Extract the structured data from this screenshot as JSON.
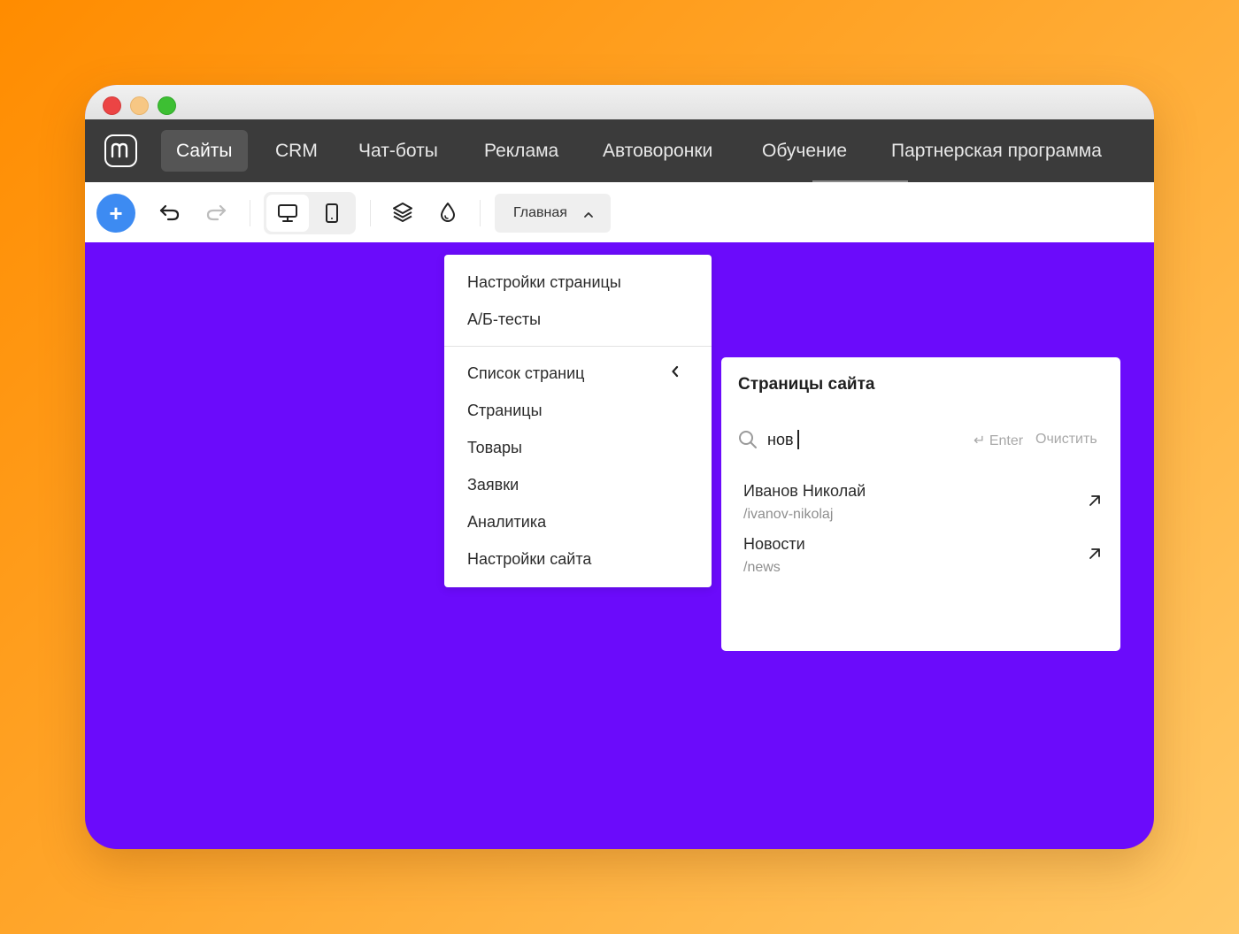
{
  "nav": {
    "items": [
      {
        "label": "Сайты",
        "active": true
      },
      {
        "label": "CRM"
      },
      {
        "label": "Чат-боты"
      },
      {
        "label": "Реклама"
      },
      {
        "label": "Автоворонки"
      },
      {
        "label": "Обучение"
      },
      {
        "label": "Партнерская программа"
      }
    ]
  },
  "toolbar": {
    "add_label": "+",
    "page_select_label": "Главная",
    "icons": [
      "undo-icon",
      "redo-icon",
      "desktop-icon",
      "mobile-icon",
      "layers-icon",
      "drop-icon",
      "chevron-up-icon"
    ]
  },
  "menu": {
    "items": [
      "Настройки страницы",
      "А/Б-тесты",
      "Список страниц",
      "Страницы",
      "Товары",
      "Заявки",
      "Аналитика",
      "Настройки сайта"
    ]
  },
  "pages_panel": {
    "title": "Страницы сайта",
    "search_value": "нов",
    "enter_hint": "↵ Enter",
    "clear_label": "Очистить",
    "results": [
      {
        "title": "Иванов Николай",
        "path": "/ivanov-nikolaj"
      },
      {
        "title": "Новости",
        "path": "/news"
      }
    ]
  },
  "colors": {
    "background_gradient": [
      "#ff8c00",
      "#ffc866"
    ],
    "canvas": "#6b0bfb",
    "navbar": "#3b3b3b",
    "accent": "#3d8bf2"
  }
}
